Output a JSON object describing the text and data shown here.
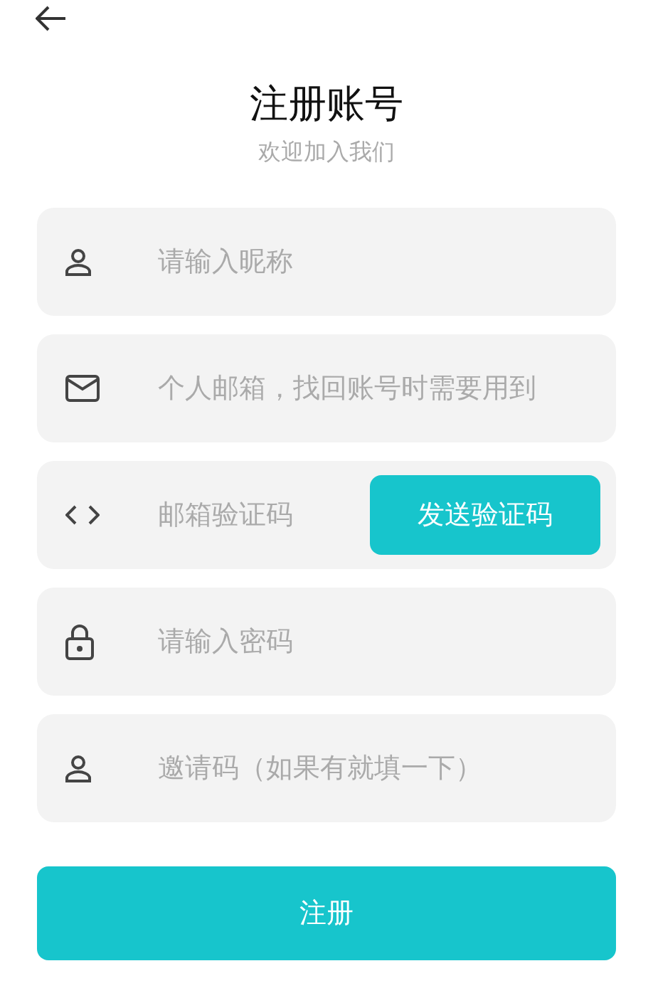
{
  "title": "注册账号",
  "subtitle": "欢迎加入我们",
  "fields": [
    {
      "kind": "nickname",
      "placeholder": "请输入昵称"
    },
    {
      "kind": "email",
      "placeholder": "个人邮箱，找回账号时需要用到"
    },
    {
      "kind": "code",
      "placeholder": "邮箱验证码",
      "button": "发送验证码"
    },
    {
      "kind": "password",
      "placeholder": "请输入密码"
    },
    {
      "kind": "invite",
      "placeholder": "邀请码（如果有就填一下）"
    }
  ],
  "submit": "注册"
}
